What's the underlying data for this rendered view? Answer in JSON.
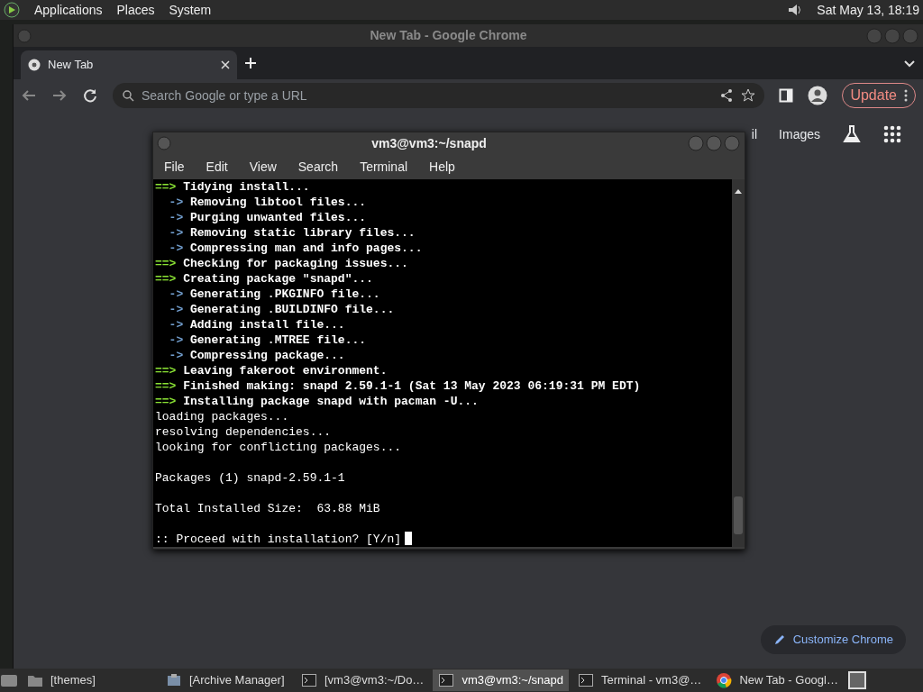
{
  "top_panel": {
    "menus": [
      "Applications",
      "Places",
      "System"
    ],
    "clock": "Sat May 13, 18:19"
  },
  "browser": {
    "title": "New Tab - Google Chrome",
    "tabs": [
      {
        "label": "New Tab",
        "selected": true
      }
    ],
    "omnibox": {
      "placeholder": "Search Google or type a URL"
    },
    "update_button": "Update",
    "ntp_links": [
      "il",
      "Images"
    ],
    "customize_button": "Customize Chrome"
  },
  "terminal": {
    "title": "vm3@vm3:~/snapd",
    "menus": [
      "File",
      "Edit",
      "View",
      "Search",
      "Terminal",
      "Help"
    ],
    "lines": [
      {
        "kind": "step",
        "prefix": "==>",
        "text": "Tidying install..."
      },
      {
        "kind": "substep",
        "prefix": "->",
        "text": "Removing libtool files..."
      },
      {
        "kind": "substep",
        "prefix": "->",
        "text": "Purging unwanted files..."
      },
      {
        "kind": "substep",
        "prefix": "->",
        "text": "Removing static library files..."
      },
      {
        "kind": "substep",
        "prefix": "->",
        "text": "Compressing man and info pages..."
      },
      {
        "kind": "step",
        "prefix": "==>",
        "text": "Checking for packaging issues..."
      },
      {
        "kind": "step",
        "prefix": "==>",
        "text": "Creating package \"snapd\"..."
      },
      {
        "kind": "substep",
        "prefix": "->",
        "text": "Generating .PKGINFO file..."
      },
      {
        "kind": "substep",
        "prefix": "->",
        "text": "Generating .BUILDINFO file..."
      },
      {
        "kind": "substep",
        "prefix": "->",
        "text": "Adding install file..."
      },
      {
        "kind": "substep",
        "prefix": "->",
        "text": "Generating .MTREE file..."
      },
      {
        "kind": "substep",
        "prefix": "->",
        "text": "Compressing package..."
      },
      {
        "kind": "step",
        "prefix": "==>",
        "text": "Leaving fakeroot environment."
      },
      {
        "kind": "step",
        "prefix": "==>",
        "text": "Finished making: snapd 2.59.1-1 (Sat 13 May 2023 06:19:31 PM EDT)"
      },
      {
        "kind": "step",
        "prefix": "==>",
        "text": "Installing package snapd with pacman -U..."
      },
      {
        "kind": "plain",
        "text": "loading packages..."
      },
      {
        "kind": "plain",
        "text": "resolving dependencies..."
      },
      {
        "kind": "plain",
        "text": "looking for conflicting packages..."
      },
      {
        "kind": "blank"
      },
      {
        "kind": "plain",
        "text": "Packages (1) snapd-2.59.1-1"
      },
      {
        "kind": "blank"
      },
      {
        "kind": "plain",
        "text": "Total Installed Size:  63.88 MiB"
      },
      {
        "kind": "blank"
      },
      {
        "kind": "prompt",
        "text": ":: Proceed with installation? [Y/n]"
      }
    ]
  },
  "taskbar": [
    {
      "label": "[themes]",
      "selected": false,
      "kind": "folder"
    },
    {
      "label": "[Archive Manager]",
      "selected": false,
      "kind": "archive"
    },
    {
      "label": "[vm3@vm3:~/Do…",
      "selected": false,
      "kind": "terminal"
    },
    {
      "label": "vm3@vm3:~/snapd",
      "selected": true,
      "kind": "terminal"
    },
    {
      "label": "Terminal - vm3@…",
      "selected": false,
      "kind": "terminal"
    },
    {
      "label": "New Tab - Googl…",
      "selected": false,
      "kind": "chrome"
    }
  ]
}
